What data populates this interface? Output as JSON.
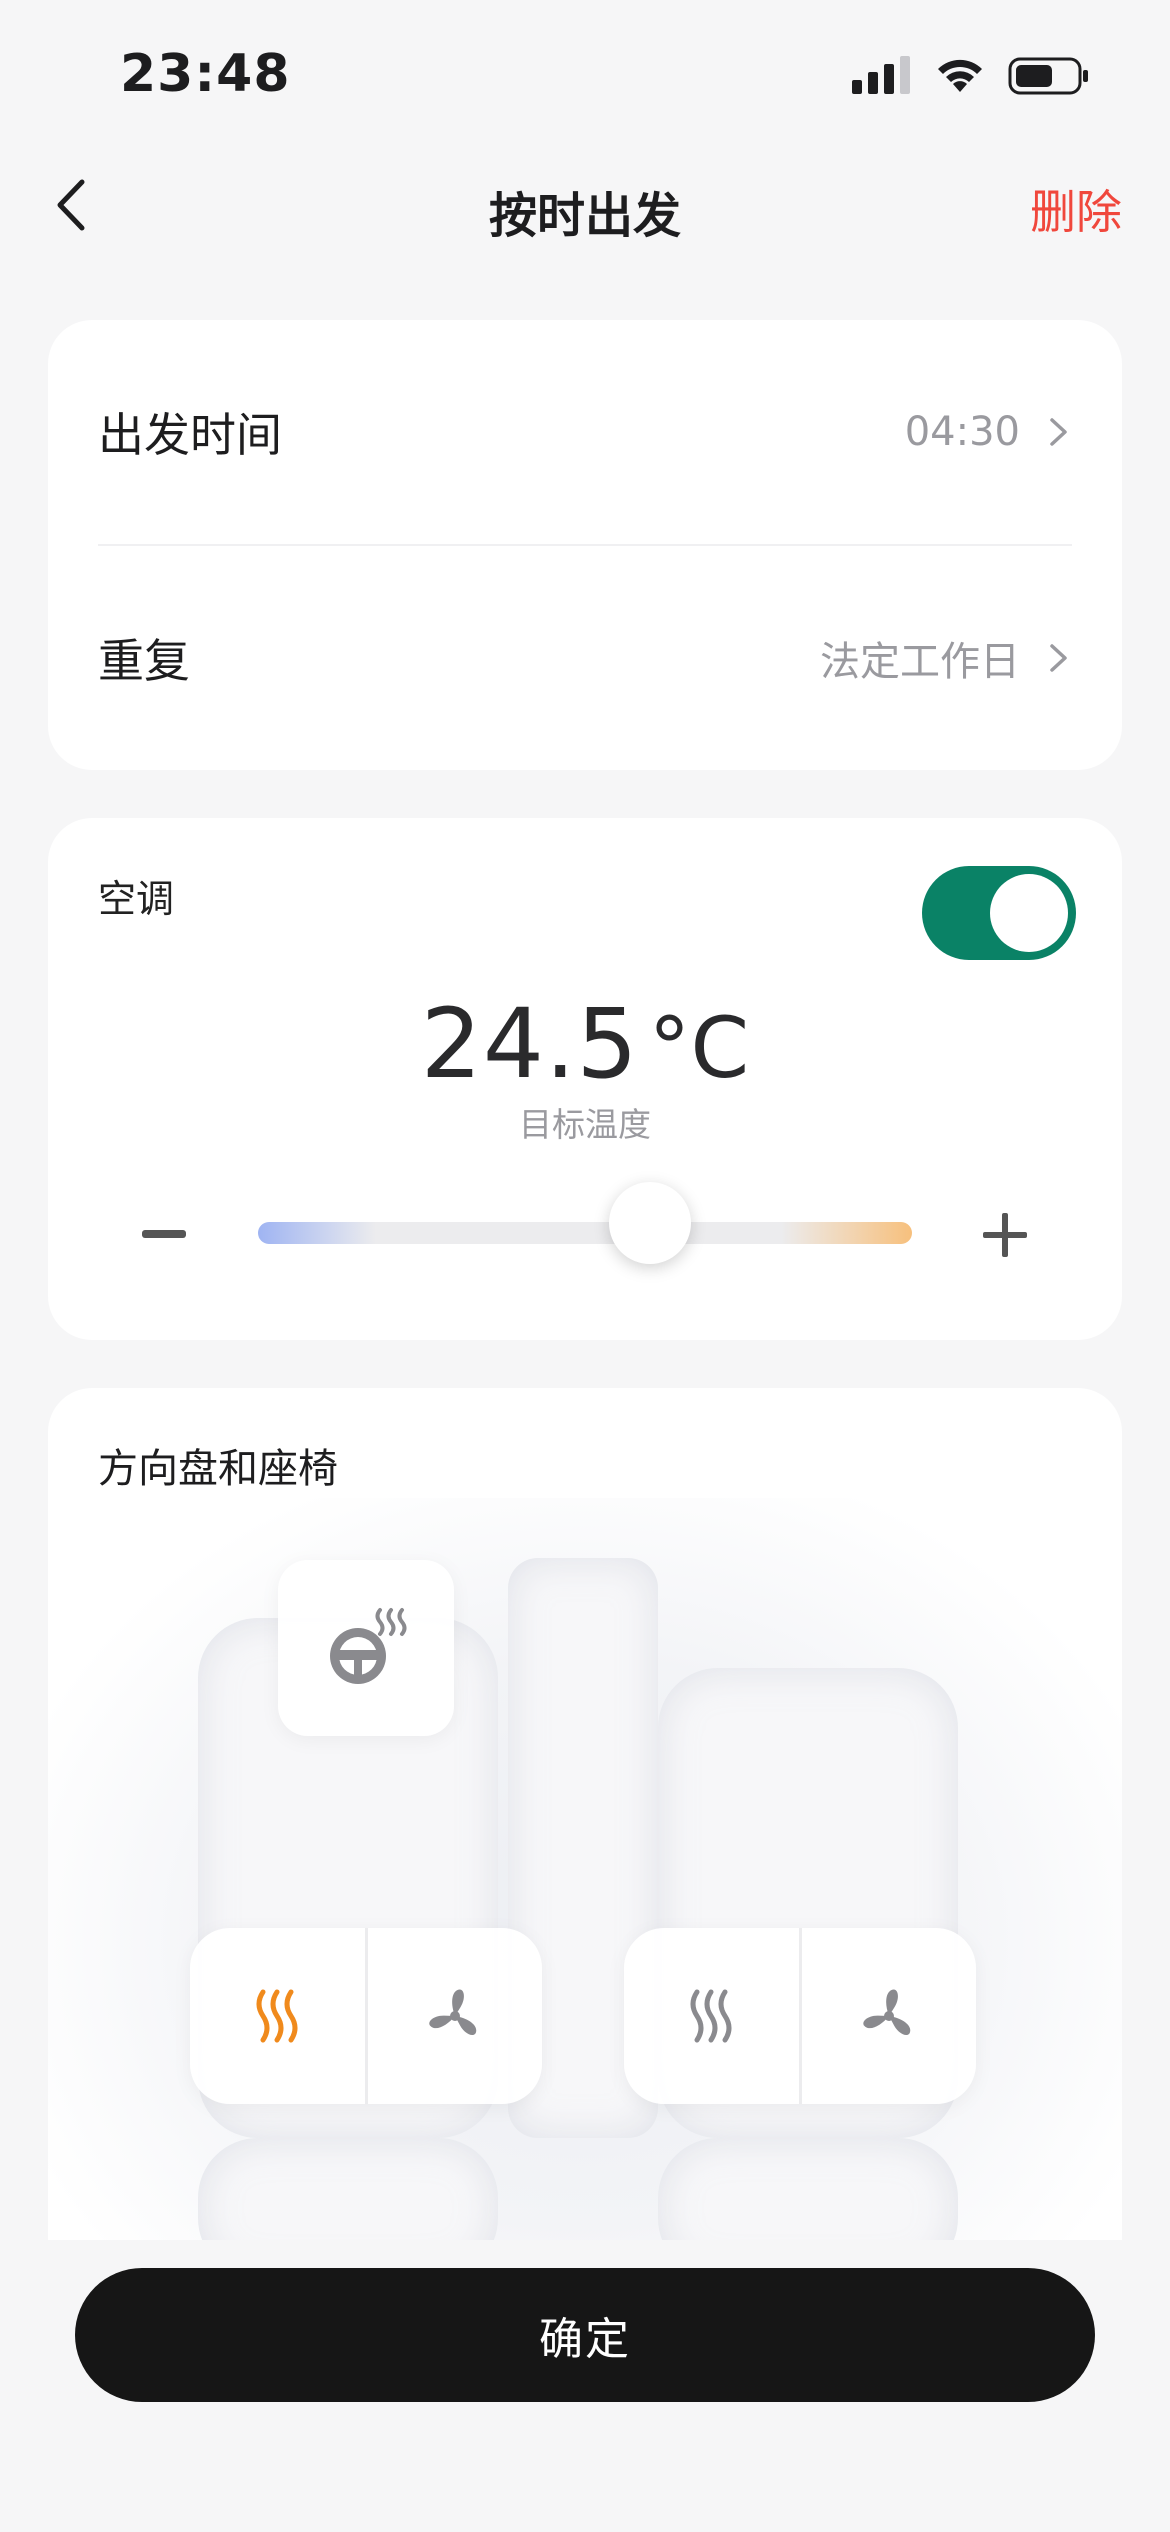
{
  "status_bar": {
    "time": "23:48"
  },
  "nav": {
    "title": "按时出发",
    "delete_label": "删除"
  },
  "schedule": {
    "departure": {
      "label": "出发时间",
      "value": "04:30"
    },
    "repeat": {
      "label": "重复",
      "value": "法定工作日"
    }
  },
  "ac": {
    "label": "空调",
    "enabled": true,
    "temperature": "24.5",
    "unit": "°C",
    "subtitle": "目标温度",
    "slider_position": 0.6
  },
  "seats": {
    "title": "方向盘和座椅",
    "left_seat": {
      "heat_active": true,
      "vent_active": false
    },
    "right_seat": {
      "heat_active": false,
      "vent_active": false
    },
    "wheel_heat_active": false
  },
  "confirm_label": "确定",
  "colors": {
    "accent_green": "#0a8266",
    "delete_red": "#f0473c",
    "heat_orange": "#f08a1c",
    "icon_gray": "#8a8a8e"
  }
}
